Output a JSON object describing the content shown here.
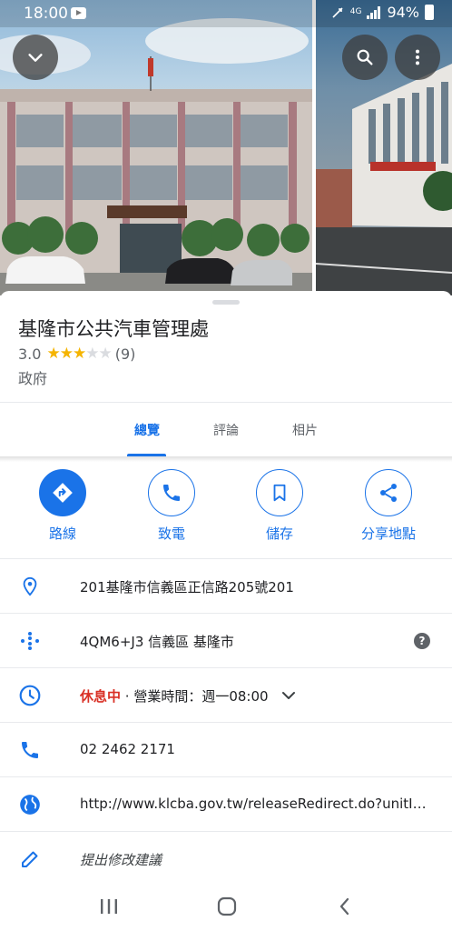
{
  "status_bar": {
    "time": "18:00",
    "network": "4G",
    "battery": "94%"
  },
  "place": {
    "name": "基隆市公共汽車管理處",
    "rating": "3.0",
    "rating_value": 3,
    "review_count": "(9)",
    "category": "政府"
  },
  "tabs": [
    {
      "label": "總覽",
      "active": true
    },
    {
      "label": "評論",
      "active": false
    },
    {
      "label": "相片",
      "active": false
    }
  ],
  "actions": [
    {
      "label": "路線",
      "icon": "directions-icon"
    },
    {
      "label": "致電",
      "icon": "phone-icon"
    },
    {
      "label": "儲存",
      "icon": "bookmark-icon"
    },
    {
      "label": "分享地點",
      "icon": "share-icon"
    }
  ],
  "info": {
    "address": "201基隆市信義區正信路205號201",
    "plus_code": "4QM6+J3 信義區 基隆市",
    "hours_status": "休息中",
    "hours_detail": " · 營業時間：週一08:00",
    "phone": "02 2462 2171",
    "website": "http://www.klcba.gov.tw/releaseRedirect.do?unitID=",
    "suggest_edit": "提出修改建議"
  },
  "colors": {
    "accent": "#1a73e8",
    "closed": "#d93025",
    "star": "#f5b400"
  }
}
